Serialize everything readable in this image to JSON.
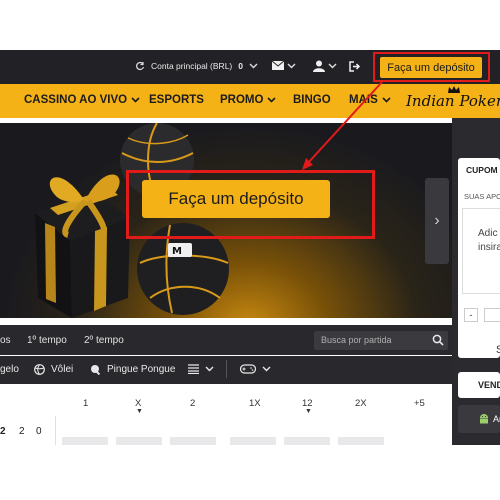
{
  "topbar": {
    "account_label": "Conta principal (BRL)",
    "balance": "0",
    "deposit_label": "Faça um depósito",
    "more": "⋮"
  },
  "nav": {
    "items": [
      "CASSINO AO VIVO",
      "ESPORTS",
      "PROMO",
      "BINGO",
      "MAIS"
    ],
    "logo": "Indian Poker"
  },
  "banner": {
    "deposit_label": "Faça um depósito",
    "next_arrow": "›"
  },
  "sidebar": {
    "cupom_title": "CUPOM",
    "cupom_sub": "SUAS APO",
    "cupom_text1": "Adic",
    "cupom_text2": "insira",
    "minus": "-",
    "s_label": "S",
    "vend_label": "VEND",
    "android_label": "Ar"
  },
  "time_filters": [
    "os",
    "1º tempo",
    "2º tempo"
  ],
  "search": {
    "placeholder": "Busca por partida"
  },
  "sports": [
    "gelo",
    "Vôlei",
    "Pingue Pongue"
  ],
  "odds": {
    "columns": [
      "1",
      "X",
      "2",
      "1X",
      "12",
      "2X",
      "+5"
    ],
    "row_scores": [
      "2",
      "2",
      "0"
    ]
  },
  "colors": {
    "accent": "#f5b217",
    "dark": "#222226",
    "annotation": "#e11a1a"
  }
}
